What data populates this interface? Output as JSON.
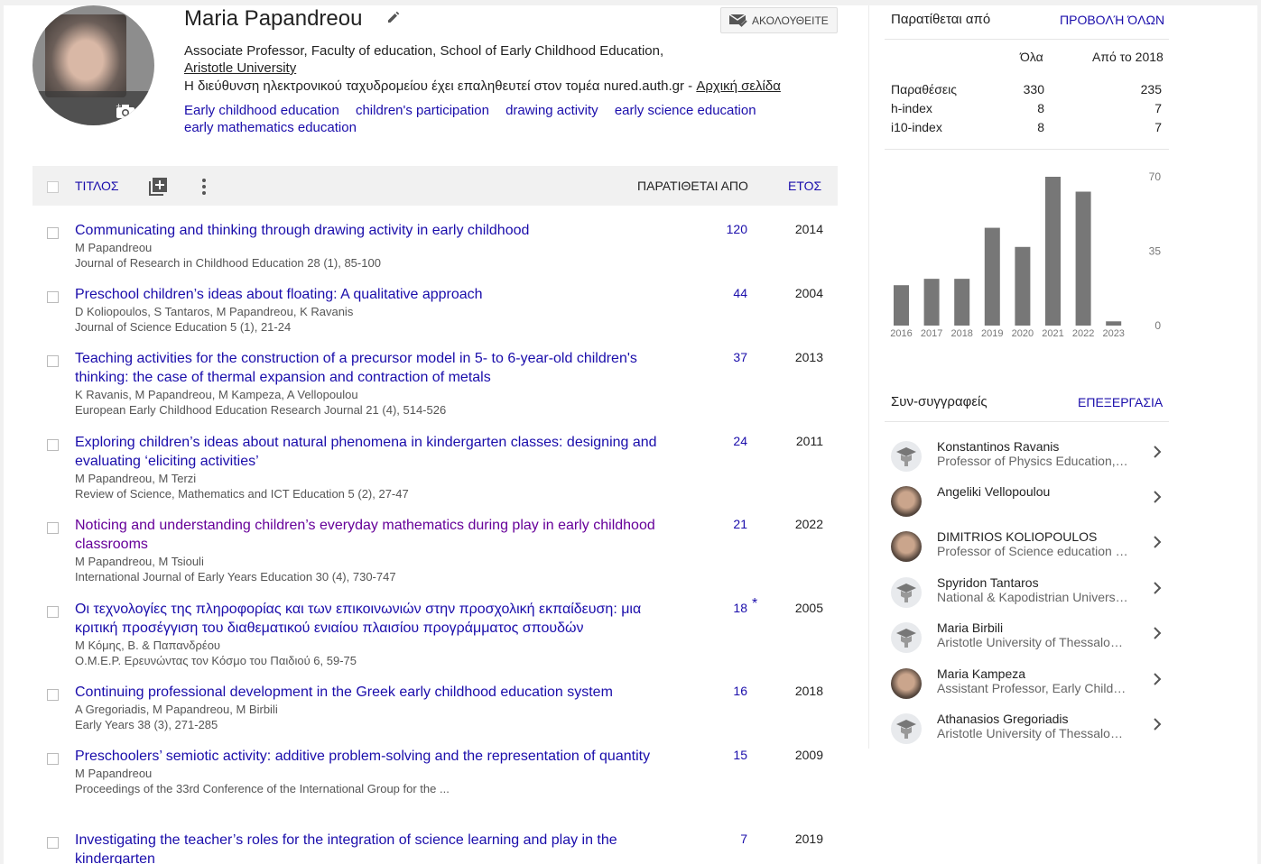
{
  "profile": {
    "name": "Maria Papandreou",
    "affiliation_line": "Associate Professor, Faculty of education, School of Early Childhood Education,",
    "university": "Aristotle University",
    "email_text": "Η διεύθυνση ηλεκτρονικού ταχυδρομείου έχει επαληθευτεί στον τομέα nured.auth.gr - ",
    "homepage_link": "Αρχική σελίδα",
    "follow_label": "ΑΚΟΛΟΥΘΕΙΤΕ",
    "interests": [
      "Early childhood education",
      "children's participation",
      "drawing activity",
      "early science education",
      "early mathematics education"
    ]
  },
  "table": {
    "title_col": "ΤΙΤΛΟΣ",
    "cited_col": "ΠΑΡΑΤΙΘΕΤΑΙ ΑΠΟ",
    "year_col": "ΕΤΟΣ"
  },
  "articles": [
    {
      "title": "Communicating and thinking through drawing activity in early childhood",
      "authors": "M Papandreou",
      "source": "Journal of Research in Childhood Education 28 (1), 85-100",
      "cited": "120",
      "year": "2014"
    },
    {
      "title": "Preschool children’s ideas about floating: A qualitative approach",
      "authors": "D Koliopoulos, S Tantaros, M Papandreou, K Ravanis",
      "source": "Journal of Science Education 5 (1), 21-24",
      "cited": "44",
      "year": "2004"
    },
    {
      "title": "Teaching activities for the construction of a precursor model in 5- to 6-year-old children's thinking: the case of thermal expansion and contraction of metals",
      "authors": "K Ravanis, M Papandreou, M Kampeza, A Vellopoulou",
      "source": "European Early Childhood Education Research Journal 21 (4), 514-526",
      "cited": "37",
      "year": "2013"
    },
    {
      "title": "Exploring children’s ideas about natural phenomena in kindergarten classes: designing and evaluating ‘eliciting activities’",
      "authors": "M Papandreou, M Terzi",
      "source": "Review of Science, Mathematics and ICT Education 5 (2), 27-47",
      "cited": "24",
      "year": "2011"
    },
    {
      "title": "Noticing and understanding children’s everyday mathematics during play in early childhood classrooms",
      "authors": "M Papandreou, M Tsiouli",
      "source": "International Journal of Early Years Education 30 (4), 730-747",
      "cited": "21",
      "year": "2022"
    },
    {
      "title": "Οι τεχνολογίες της πληροφορίας και των επικοινωνιών στην προσχολική εκπαίδευση: μια κριτική προσέγγιση του διαθεματικού ενιαίου πλαισίου προγράμματος σπουδών",
      "authors": "Μ Κόμης, Β. & Παπανδρέου",
      "source": "Ο.Μ.Ε.Ρ. Ερευνώντας τον Κόσμο του Παιδιού 6, 59-75",
      "cited": "18",
      "star": "*",
      "year": "2005"
    },
    {
      "title": "Continuing professional development in the Greek early childhood education system",
      "authors": "A Gregoriadis, M Papandreou, M Birbili",
      "source": "Early Years 38 (3), 271-285",
      "cited": "16",
      "year": "2018"
    },
    {
      "title": "Preschoolers’ semiotic activity: additive problem-solving and the representation of quantity",
      "authors": "M Papandreou",
      "source": "Proceedings of the 33rd Conference of the International Group for the ...",
      "cited": "15",
      "year": "2009"
    },
    {
      "title": "Investigating the teacher’s roles for the integration of science learning and play in the kindergarten",
      "authors": "",
      "source": "",
      "cited": "7",
      "year": "2019"
    }
  ],
  "metrics": {
    "heading": "Παρατίθεται από",
    "view_all": "ΠΡΟΒΟΛΉ ΌΛΩΝ",
    "col_all": "Όλα",
    "col_since": "Από το 2018",
    "rows": [
      {
        "label": "Παραθέσεις",
        "all": "330",
        "since": "235"
      },
      {
        "label": "h-index",
        "all": "8",
        "since": "7"
      },
      {
        "label": "i10-index",
        "all": "8",
        "since": "7"
      }
    ]
  },
  "chart_data": {
    "type": "bar",
    "categories": [
      "2016",
      "2017",
      "2018",
      "2019",
      "2020",
      "2021",
      "2022",
      "2023"
    ],
    "values": [
      19,
      22,
      22,
      46,
      37,
      70,
      63,
      2
    ],
    "ylim": [
      0,
      70
    ],
    "yticks": [
      "70",
      "35",
      "0"
    ],
    "bar_color": "#777777"
  },
  "coauthors": {
    "heading": "Συν-συγγραφείς",
    "edit": "ΕΠΕΞΕΡΓΑΣΙΑ",
    "items": [
      {
        "name": "Konstantinos Ravanis",
        "affil": "Professor of Physics Education, University of Patras",
        "avatar": "placeholder"
      },
      {
        "name": "Angeliki Vellopoulou",
        "affil": "",
        "avatar": "photo"
      },
      {
        "name": "DIMITRIOS KOLIOPOULOS",
        "affil": "Professor of Science education and Didactics",
        "avatar": "photo"
      },
      {
        "name": "Spyridon Tantaros",
        "affil": "National & Kapodistrian University of Athens",
        "avatar": "placeholder"
      },
      {
        "name": "Maria Birbili",
        "affil": "Aristotle University of Thessaloniki",
        "avatar": "placeholder"
      },
      {
        "name": "Maria Kampeza",
        "affil": "Assistant Professor, Early Childhood Education",
        "avatar": "photo"
      },
      {
        "name": "Athanasios Gregoriadis",
        "affil": "Aristotle University of Thessaloniki",
        "avatar": "placeholder"
      }
    ]
  }
}
